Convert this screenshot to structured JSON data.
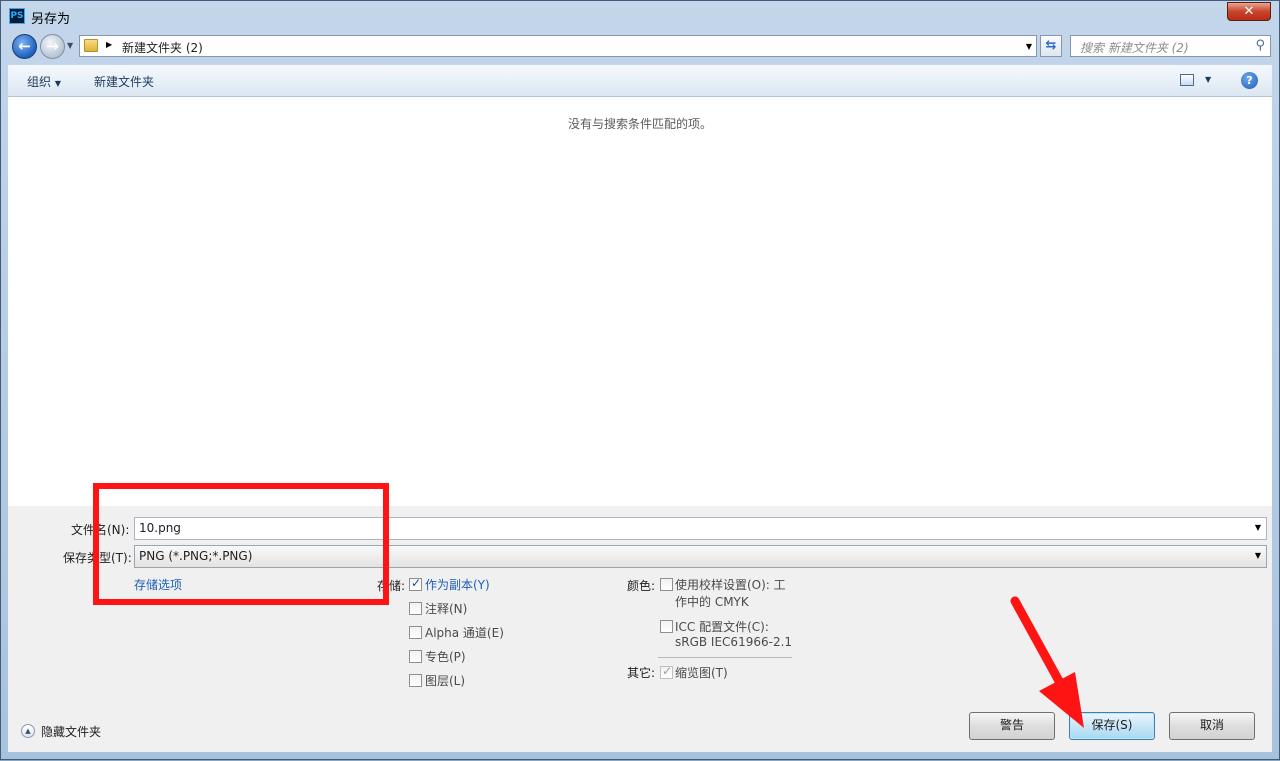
{
  "window": {
    "title": "另存为",
    "app_icon": "PS",
    "close_symbol": "✕"
  },
  "nav": {
    "path": "新建文件夹 (2)",
    "search_placeholder": "搜索 新建文件夹 (2)"
  },
  "toolbar": {
    "organize_label": "组织",
    "new_folder_label": "新建文件夹"
  },
  "content": {
    "empty_message": "没有与搜索条件匹配的项。"
  },
  "form": {
    "filename_label": "文件名(N):",
    "filename_value": "10.png",
    "filetype_label": "保存类型(T):",
    "filetype_value": "PNG (*.PNG;*.PNG)",
    "save_options_link": "存储选项"
  },
  "storage": {
    "label": "存储:",
    "options": [
      {
        "label": "作为副本(Y)",
        "checked": true
      },
      {
        "label": "注释(N)",
        "checked": false
      },
      {
        "label": "Alpha 通道(E)",
        "checked": false
      },
      {
        "label": "专色(P)",
        "checked": false
      },
      {
        "label": "图层(L)",
        "checked": false
      }
    ]
  },
  "color": {
    "label": "颜色:",
    "proof_line1": "使用校样设置(O): 工",
    "proof_line2": "作中的 CMYK",
    "icc_line1": "ICC 配置文件(C):",
    "icc_line2": "sRGB IEC61966-2.1"
  },
  "other": {
    "label": "其它:",
    "thumbnail_label": "缩览图(T)"
  },
  "footer": {
    "hide_folders_label": "隐藏文件夹",
    "warning_label": "警告",
    "save_label": "保存(S)",
    "cancel_label": "取消"
  },
  "annotation_color": "#ff1414"
}
